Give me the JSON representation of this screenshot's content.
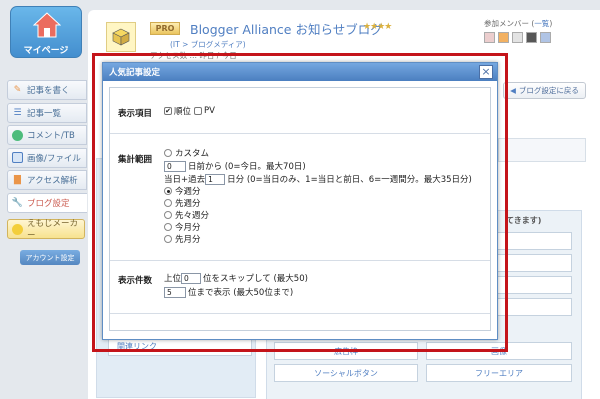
{
  "sidebar": {
    "home_label": "マイページ",
    "items": [
      {
        "label": "記事を書く",
        "icon": "pencil-icon",
        "color": "#e67e22"
      },
      {
        "label": "記事一覧",
        "icon": "list-icon",
        "color": "#2a63b5"
      },
      {
        "label": "コメント/TB",
        "icon": "speech-bubble-icon",
        "color": "#27ae60"
      },
      {
        "label": "画像/ファイル",
        "icon": "image-icon",
        "color": "#2a63b5"
      },
      {
        "label": "アクセス解析",
        "icon": "bar-chart-icon",
        "color": "#e67e22"
      },
      {
        "label": "ブログ設定",
        "icon": "wrench-icon",
        "color": "#c0392b"
      }
    ],
    "emoji_label": "えもじメーカー",
    "account_label": "アカウント設定"
  },
  "header": {
    "pro_badge": "PRO",
    "blog_title": "Blogger Alliance お知らせブログ",
    "stars": "★★★★",
    "sub_link": "(IT > ブログメディア)",
    "meta": "アクセス数 … 昨日 / 今日",
    "members_label": "参加メンバー (",
    "members_link": "一覧",
    "members_close": ")",
    "back_button": "ブログ設定に戻る"
  },
  "background": {
    "related_link": "関連リンク",
    "note": "てきます)",
    "cells": [
      "",
      "",
      "",
      "",
      "",
      "",
      "",
      "",
      "広告枠",
      "画像",
      "ソーシャルボタン",
      "フリーエリア"
    ]
  },
  "dialog": {
    "title": "人気記事設定",
    "display_item": {
      "label": "表示項目",
      "options": [
        {
          "label": "順位",
          "checked": true
        },
        {
          "label": "PV",
          "checked": false
        }
      ]
    },
    "range": {
      "label": "集計範囲",
      "custom_label": "カスタム",
      "days_before_value": "0",
      "days_before_text": "日前から (0=今日。最大70日)",
      "prefix": "当日+過去",
      "days_value": "1",
      "days_text": "日分 (0=当日のみ、1=当日と前日、6=一週間分。最大35日分)",
      "options": [
        {
          "label": "今週分",
          "selected": true
        },
        {
          "label": "先週分",
          "selected": false
        },
        {
          "label": "先々週分",
          "selected": false
        },
        {
          "label": "今月分",
          "selected": false
        },
        {
          "label": "先月分",
          "selected": false
        }
      ]
    },
    "count": {
      "label": "表示件数",
      "skip_prefix": "上位",
      "skip_value": "0",
      "skip_text": "位をスキップして (最大50)",
      "show_value": "5",
      "show_text": "位まで表示 (最大50位まで)"
    }
  },
  "colors": {
    "accent": "#2a63b5",
    "highlight_frame": "#c4141a",
    "dialog_header": "#5a8ccb"
  }
}
